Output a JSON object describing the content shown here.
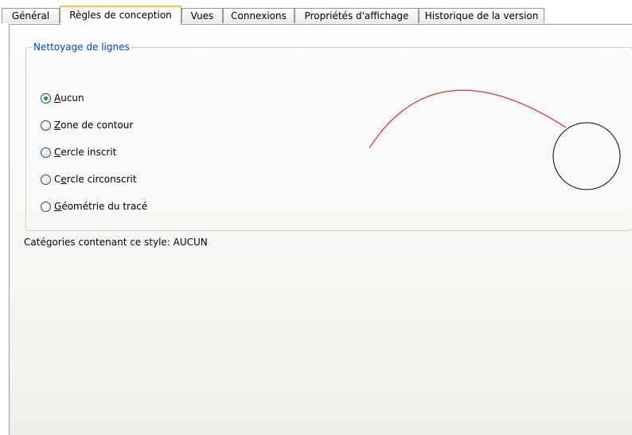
{
  "tabs": [
    {
      "label": "Général",
      "active": false
    },
    {
      "label": "Règles de conception",
      "active": true
    },
    {
      "label": "Vues",
      "active": false
    },
    {
      "label": "Connexions",
      "active": false
    },
    {
      "label": "Propriétés d'affichage",
      "active": false
    },
    {
      "label": "Historique de la version",
      "active": false
    }
  ],
  "line_cleanup": {
    "title": "Nettoyage de lignes",
    "options": [
      {
        "label": "Aucun",
        "mnemonic": "A",
        "checked": true
      },
      {
        "label": "Zone de contour",
        "mnemonic": "Z",
        "checked": false
      },
      {
        "label": "Cercle inscrit",
        "mnemonic": "C",
        "checked": false
      },
      {
        "label": "Cercle circonscrit",
        "mnemonic": "e",
        "checked": false
      },
      {
        "label": "Géométrie du tracé",
        "mnemonic": "G",
        "checked": false
      }
    ]
  },
  "categories_text": "Catégories contenant ce style: AUCUN",
  "colors": {
    "group_title": "#0046d5",
    "preview_arc": "#ff0000",
    "preview_circle": "#000000",
    "active_tab_accent": "#ffc83c",
    "radio_checked_dot": "#21a121"
  }
}
